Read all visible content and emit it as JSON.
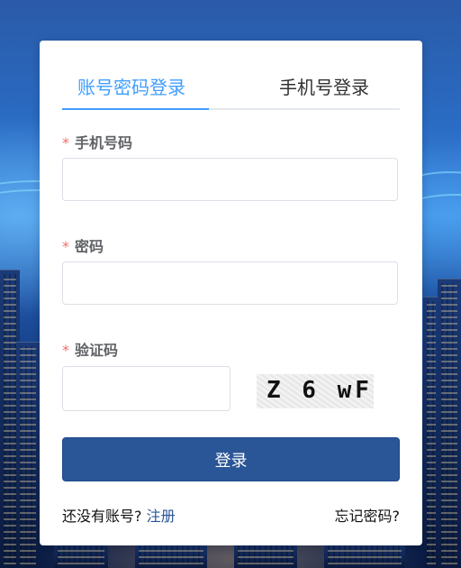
{
  "tabs": {
    "password_login": "账号密码登录",
    "phone_login": "手机号登录"
  },
  "form": {
    "required_mark": "*",
    "phone_label": "手机号码",
    "phone_value": "",
    "password_label": "密码",
    "password_value": "",
    "captcha_label": "验证码",
    "captcha_value": "",
    "captcha_image_text": "Z 6 wF"
  },
  "actions": {
    "login_button": "登录",
    "no_account_text": "还没有账号?",
    "register_link": "注册",
    "forgot_password_link": "忘记密码?"
  },
  "colors": {
    "accent": "#409eff",
    "primary_button": "#2a5596",
    "required": "#f56c6c"
  }
}
